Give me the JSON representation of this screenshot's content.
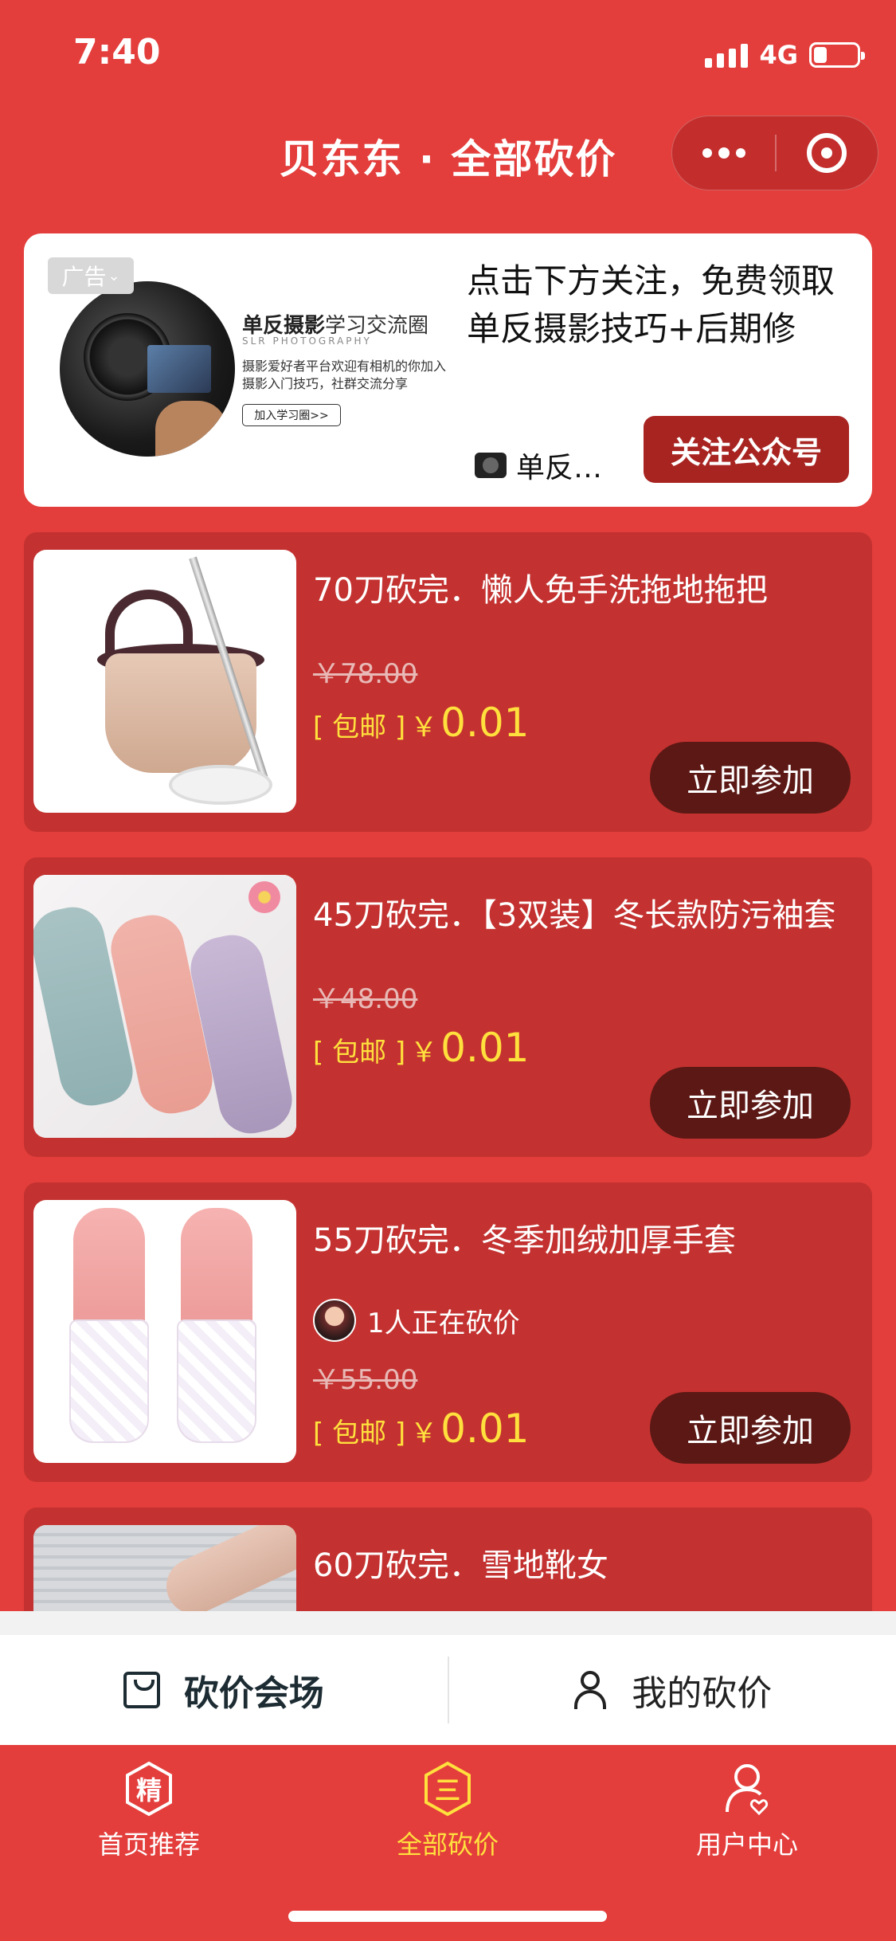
{
  "status_bar": {
    "time": "7:40",
    "network": "4G",
    "battery_level": 0.3
  },
  "nav": {
    "title": "贝东东 · 全部砍价"
  },
  "ad": {
    "tag": "广告",
    "image_title_bold": "单反摄影",
    "image_title_rest": "学习交流圈",
    "image_subtitle": "SLR PHOTOGRAPHY",
    "image_desc": "摄影爱好者平台欢迎有相机的你加入摄影入门技巧，社群交流分享",
    "image_button": "加入学习圈>>",
    "headline": "点击下方关注，免费领取单反摄影技巧+后期修",
    "source": "单反…",
    "follow_button": "关注公众号"
  },
  "products": [
    {
      "title": "70刀砍完．懒人免手洗拖地拖把",
      "original_price": "￥78.00",
      "shipping": "[ 包邮 ]",
      "currency": "￥",
      "price": "0.01",
      "button": "立即参加"
    },
    {
      "title": "45刀砍完．【3双装】冬长款防污袖套",
      "original_price": "￥48.00",
      "shipping": "[ 包邮 ]",
      "currency": "￥",
      "price": "0.01",
      "button": "立即参加"
    },
    {
      "title": "55刀砍完．冬季加绒加厚手套",
      "bargaining": "1人正在砍价",
      "original_price": "￥55.00",
      "shipping": "[ 包邮 ]",
      "currency": "￥",
      "price": "0.01",
      "button": "立即参加"
    },
    {
      "title": "60刀砍完．雪地靴女"
    }
  ],
  "sub_tabs": [
    {
      "label": "砍价会场",
      "icon": "bag-icon",
      "active": true
    },
    {
      "label": "我的砍价",
      "icon": "user-icon",
      "active": false
    }
  ],
  "tabbar": [
    {
      "label": "首页推荐",
      "glyph": "精",
      "icon": "hexagon-jing-icon"
    },
    {
      "label": "全部砍价",
      "glyph": "三",
      "icon": "hexagon-list-icon",
      "active": true
    },
    {
      "label": "用户中心",
      "icon": "user-heart-icon"
    }
  ],
  "colors": {
    "brand_red": "#E33E3C",
    "card_red": "#C33230",
    "price_yellow": "#FFE03D",
    "button_dark": "#5B1815"
  }
}
